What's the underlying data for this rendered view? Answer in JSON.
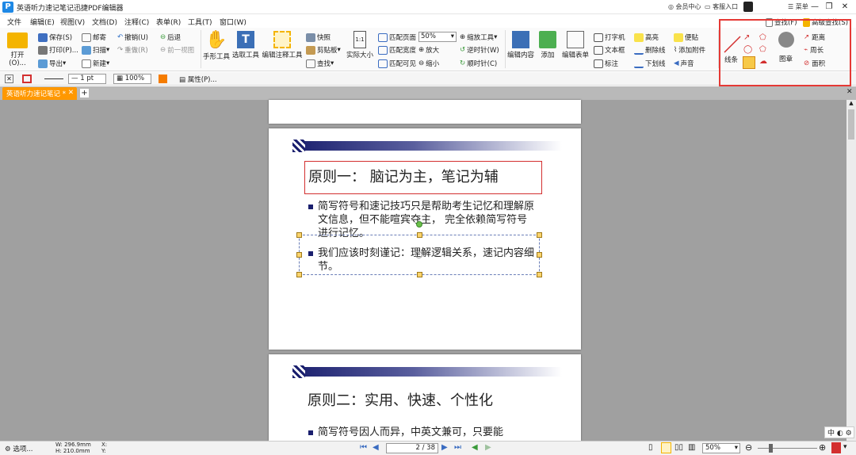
{
  "window": {
    "title": "英语听力速记笔记迅捷PDF编辑器",
    "member": "会员中心",
    "feedback": "客服入口",
    "menu": "菜单"
  },
  "menu": [
    "文件",
    "编辑(E)",
    "视图(V)",
    "文档(D)",
    "注释(C)",
    "表单(R)",
    "工具(T)",
    "窗口(W)"
  ],
  "ribbon": {
    "open": "打开(O)...",
    "save": "保存(S)",
    "print": "打印(P)...",
    "export": "导出",
    "mail": "邮寄",
    "scan": "扫描",
    "new": "新建",
    "undo": "撤销(U)",
    "redo": "重做(R)",
    "back": "后退",
    "prev_view": "前一视图",
    "hand": "手形工具",
    "select": "选取工具",
    "edit_annot": "编辑注释工具",
    "snapshot": "快照",
    "clipboard": "剪贴板",
    "find": "查找",
    "actual": "实际大小",
    "fit_page": "匹配页面",
    "fit_width": "匹配宽度",
    "fit_visible": "匹配可见",
    "zoom_value": "50%",
    "zoom_tool": "缩放工具",
    "zoom_in": "放大",
    "zoom_out": "缩小",
    "ccw": "逆时针(W)",
    "cw": "顺时针(C)",
    "edit_content": "编辑内容",
    "add": "添加",
    "edit_form": "编辑表单",
    "typewriter": "打字机",
    "textbox": "文本框",
    "callout": "标注",
    "highlight": "高亮",
    "strikeout": "删除线",
    "underline": "下划线",
    "note": "便贴",
    "attach": "添加附件",
    "sound": "声音",
    "find_top": "查找(F)",
    "adv_find": "高级查找(S)",
    "line": "线条",
    "stamp": "图章",
    "distance": "距离",
    "perimeter": "周长",
    "area": "面积"
  },
  "propbar": {
    "line_width": "1 pt",
    "opacity": "100%",
    "props": "属性(P)..."
  },
  "tab": {
    "label": "英语听力速记笔记 *"
  },
  "page1": {
    "title": "原则一： 脑记为主，笔记为辅",
    "bullet1": "简写符号和速记技巧只是帮助考生记忆和理解原文信息，但不能喧宾夺主， 完全依赖简写符号进行记忆。",
    "bullet2": "我们应该时刻谨记：理解逻辑关系，速记内容细节。"
  },
  "page2": {
    "title": "原则二：实用、快速、个性化",
    "bullet1": "简写符号因人而异，中英文兼可，只要能"
  },
  "status": {
    "options": "选项...",
    "w": "W: 296.9mm",
    "h": "H: 210.0mm",
    "x": "X:",
    "y": "Y:",
    "page": "2",
    "total": "/ 38",
    "zoom": "50%",
    "ime": "中"
  }
}
